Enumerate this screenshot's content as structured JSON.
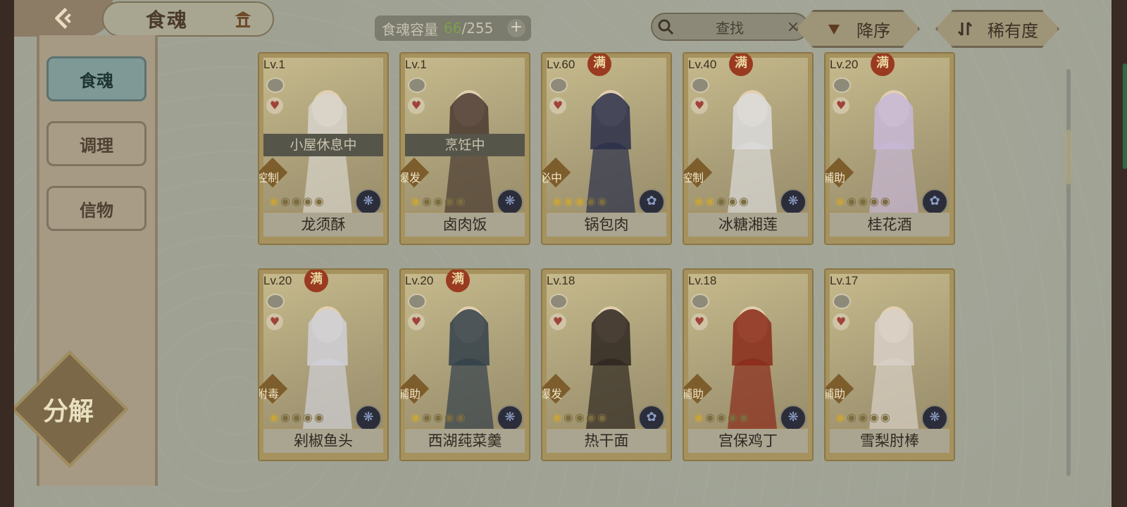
{
  "header": {
    "title": "食魂",
    "capacity_label": "食魂容量",
    "capacity_used": "66",
    "capacity_total": "/255",
    "plus": "+",
    "search_placeholder": "查找",
    "search_clear": "×",
    "sort_order_label": "降序",
    "sort_field_label": "稀有度"
  },
  "sidebar": {
    "tabs": [
      {
        "label": "食魂",
        "active": true
      },
      {
        "label": "调理",
        "active": false
      },
      {
        "label": "信物",
        "active": false
      }
    ],
    "decompose_label": "分解"
  },
  "cards": [
    {
      "level": "Lv.1",
      "full": "",
      "status": "小屋休息中",
      "role": "控制",
      "name": "龙须酥",
      "stars_filled": 1,
      "stars_total": 5,
      "element": "flower"
    },
    {
      "level": "Lv.1",
      "full": "",
      "status": "烹饪中",
      "role": "爆发",
      "name": "卤肉饭",
      "stars_filled": 1,
      "stars_total": 5,
      "element": "flower"
    },
    {
      "level": "Lv.60",
      "full": "满",
      "status": "",
      "role": "必中",
      "name": "锅包肉",
      "stars_filled": 3,
      "stars_total": 5,
      "element": "leaf"
    },
    {
      "level": "Lv.40",
      "full": "满",
      "status": "",
      "role": "控制",
      "name": "冰糖湘莲",
      "stars_filled": 2,
      "stars_total": 5,
      "element": "flower"
    },
    {
      "level": "Lv.20",
      "full": "满",
      "status": "",
      "role": "辅助",
      "name": "桂花酒",
      "stars_filled": 1,
      "stars_total": 5,
      "element": "leaf"
    },
    {
      "level": "Lv.20",
      "full": "满",
      "status": "",
      "role": "附毒",
      "name": "剁椒鱼头",
      "stars_filled": 1,
      "stars_total": 5,
      "element": "flower"
    },
    {
      "level": "Lv.20",
      "full": "满",
      "status": "",
      "role": "辅助",
      "name": "西湖莼菜羹",
      "stars_filled": 1,
      "stars_total": 5,
      "element": "flower"
    },
    {
      "level": "Lv.18",
      "full": "",
      "status": "",
      "role": "爆发",
      "name": "热干面",
      "stars_filled": 1,
      "stars_total": 5,
      "element": "leaf"
    },
    {
      "level": "Lv.18",
      "full": "",
      "status": "",
      "role": "辅助",
      "name": "宫保鸡丁",
      "stars_filled": 1,
      "stars_total": 5,
      "element": "flower"
    },
    {
      "level": "Lv.17",
      "full": "",
      "status": "",
      "role": "辅助",
      "name": "雪梨肘棒",
      "stars_filled": 1,
      "stars_total": 5,
      "element": "flower"
    }
  ],
  "colors": {
    "accent_gold": "#c8a43a",
    "capacity_used": "#7ea04d",
    "active_tab": "#7f9a96"
  }
}
